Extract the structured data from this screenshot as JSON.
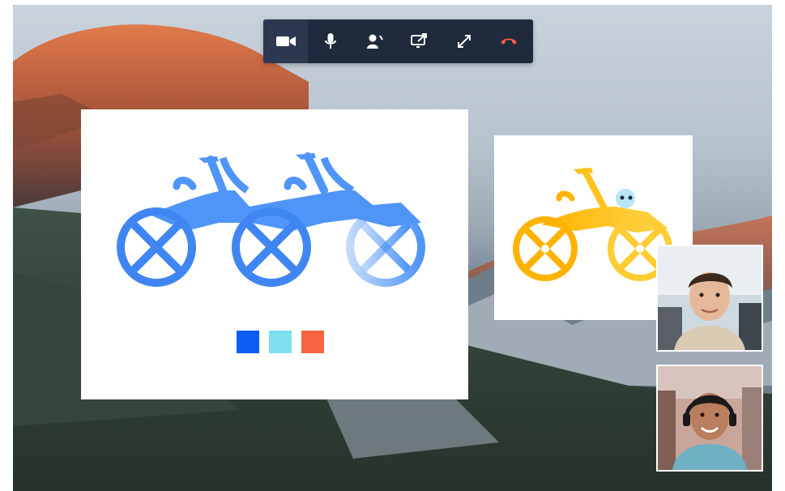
{
  "toolbar": {
    "buttons": [
      {
        "icon": "video-camera-icon",
        "label": ""
      },
      {
        "icon": "microphone-icon",
        "label": ""
      },
      {
        "icon": "participants-icon",
        "label": ""
      },
      {
        "icon": "screen-share-icon",
        "label": ""
      },
      {
        "icon": "fullscreen-icon",
        "label": ""
      },
      {
        "icon": "end-call-icon",
        "label": ""
      }
    ],
    "active": "video-camera-icon",
    "colors": {
      "bar": "#1f2a3d",
      "icon": "#ffffff",
      "end_call": "#ff5a36"
    }
  },
  "shared_screen": {
    "illustration": "blue-tandem-bicycle",
    "swatches": [
      "#0b5cf5",
      "#7ee0ee",
      "#f7633f"
    ]
  },
  "preview": {
    "illustration": "yellow-bicycle"
  },
  "participants": [
    {
      "name": "participant-1"
    },
    {
      "name": "participant-2"
    }
  ]
}
